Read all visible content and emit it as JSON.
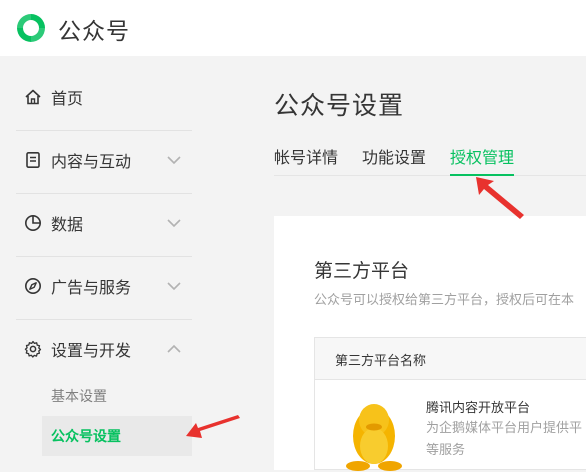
{
  "header": {
    "brand": "公众号",
    "logo_icon": "wechat-official-account-logo-icon"
  },
  "sidebar": {
    "items": [
      {
        "label": "首页",
        "icon": "home-icon"
      },
      {
        "label": "内容与互动",
        "icon": "document-icon"
      },
      {
        "label": "数据",
        "icon": "pie-chart-icon"
      },
      {
        "label": "广告与服务",
        "icon": "compass-icon"
      },
      {
        "label": "设置与开发",
        "icon": "gear-icon"
      }
    ],
    "subitems": [
      "基本设置",
      "公众号设置"
    ]
  },
  "page": {
    "title": "公众号设置",
    "tabs": [
      "帐号详情",
      "功能设置",
      "授权管理"
    ],
    "active_tab": "授权管理"
  },
  "card": {
    "title": "第三方平台",
    "description": "公众号可以授权给第三方平台，授权后可在本",
    "table_header": "第三方平台名称",
    "row": {
      "name": "腾讯内容开放平台",
      "desc_line1": "为企鹅媒体平台用户提供平",
      "desc_line2": "等服务"
    }
  },
  "colors": {
    "accent": "#07c160",
    "annotation_arrow": "#e8322e"
  }
}
